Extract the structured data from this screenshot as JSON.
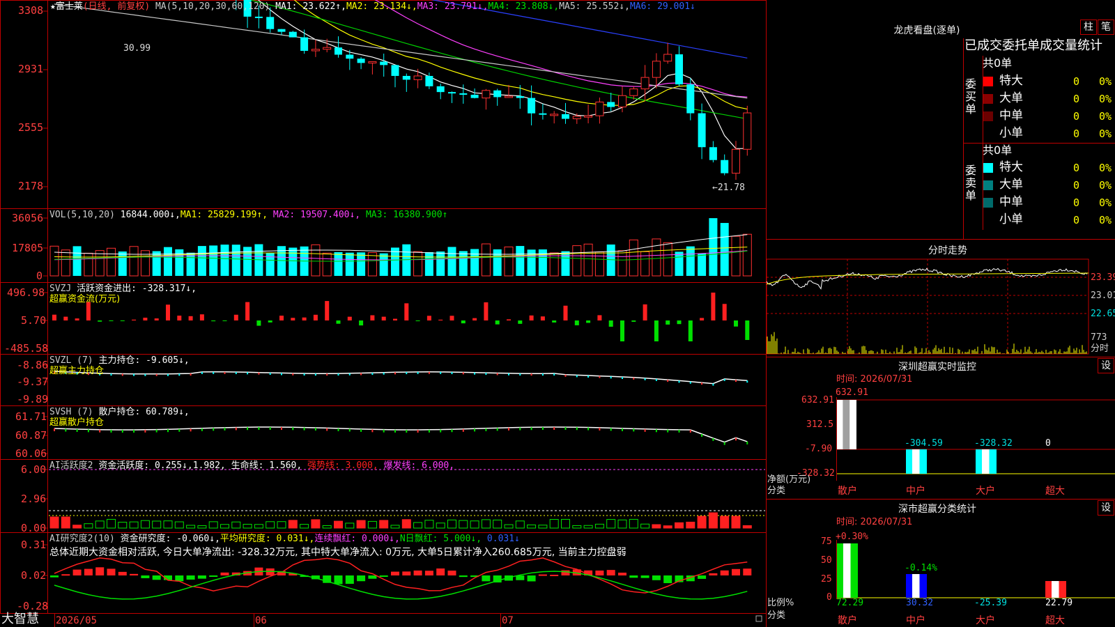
{
  "app": {
    "logo": "大智慧"
  },
  "main": {
    "price_ticks": [
      "3308",
      "2931",
      "2555",
      "2178"
    ],
    "header": {
      "star": "★",
      "name": "富士莱",
      "period": "(日线, 前复权)",
      "ma_label": "MA(5,10,20,30,60,120)",
      "ma1": "MA1: 23.622↑,",
      "ma2": "MA2: 23.134↓,",
      "ma3": "MA3: 23.791↓,",
      "ma4": "MA4: 23.808↓,",
      "ma5": "MA5: 25.552↓,",
      "ma6": "MA6: 29.001↓"
    },
    "high_label": "30.99",
    "low_label": "←21.78"
  },
  "vol": {
    "ticks": [
      "36056",
      "17805",
      "0"
    ],
    "name": "VOL(5,10,20)",
    "value": "16844.000↓,",
    "ma1": "MA1: 25829.199↑,",
    "ma2": "MA2: 19507.400↓,",
    "ma3": "MA3: 16380.900↑"
  },
  "svzj": {
    "ticks": [
      "496.98",
      "5.70",
      "-485.58"
    ],
    "name": "SVZJ",
    "value": "活跃资金进出: -328.317↓,",
    "sub": "超赢资金流(万元)"
  },
  "svzl": {
    "ticks": [
      "-8.86",
      "-9.37",
      "-9.89"
    ],
    "name": "SVZL (7)",
    "value": "主力持仓: -9.605↓,",
    "sub": "超赢主力持仓"
  },
  "svsh": {
    "ticks": [
      "61.71",
      "60.87",
      "60.06"
    ],
    "name": "SVSH (7)",
    "value": "散户持仓: 60.789↓,",
    "sub": "超赢散户持仓"
  },
  "ai1": {
    "ticks": [
      "6.00",
      "2.96",
      "0.00"
    ],
    "name": "AI活跃度2",
    "value": "资金活跃度: 0.255↓,",
    "v2": "1.982,",
    "v3": "生命线: 1.560,",
    "v4": "强势线: 3.000,",
    "v5": "爆发线: 6.000,"
  },
  "ai2": {
    "ticks": [
      "0.31",
      "0.02",
      "-0.28"
    ],
    "name": "AI研究度2(10)",
    "v1": "资金研究度: -0.060↓,",
    "v2": "平均研究度: 0.031↓,",
    "v3": "连续飘红: 0.000↓,",
    "v4": "N日飘红: 5.000↓,",
    "v5": "0.031↓",
    "summary": "总体近期大资金相对活跃, 今日大单净流出: -328.32万元, 其中特大单净流入: 0万元, 大单5日累计净入260.685万元, 当前主力控盘弱"
  },
  "time_axis": {
    "d1": "2026/05",
    "d2": "06",
    "d3": "07"
  },
  "lhb": {
    "title": "龙虎看盘(逐单)",
    "btn1": "柱",
    "btn2": "笔",
    "tabs": "已成交委托单成交量统计",
    "buy_label": "委买单",
    "sell_label": "委卖单",
    "total_buy": "共0单",
    "total_sell": "共0单",
    "buy_rows": [
      {
        "label": "特大",
        "count": "0",
        "pct": "0%"
      },
      {
        "label": "大单",
        "count": "0",
        "pct": "0%"
      },
      {
        "label": "中单",
        "count": "0",
        "pct": "0%"
      },
      {
        "label": "小单",
        "count": "0",
        "pct": "0%"
      }
    ],
    "sell_rows": [
      {
        "label": "特大",
        "count": "0",
        "pct": "0%"
      },
      {
        "label": "大单",
        "count": "0",
        "pct": "0%"
      },
      {
        "label": "中单",
        "count": "0",
        "pct": "0%"
      },
      {
        "label": "小单",
        "count": "0",
        "pct": "0%"
      }
    ]
  },
  "fenshi": {
    "title": "分时走势",
    "ticks": [
      "23.39",
      "23.01",
      "22.65"
    ],
    "vol_tick": "773",
    "vol_label": "分时"
  },
  "sz_monitor": {
    "title": "深圳超赢实时监控",
    "btn": "设",
    "time": "时间: 2026/07/31",
    "ticks": [
      "632.91",
      "312.5",
      "-7.90",
      "-328.32"
    ],
    "unit1": "净额(万元)",
    "unit2": "分类",
    "cats": [
      "散户",
      "中户",
      "大户",
      "超大"
    ],
    "values": [
      "632.91",
      "-304.59",
      "-328.32",
      "0"
    ]
  },
  "sz_class": {
    "title": "深市超赢分类统计",
    "btn": "设",
    "time": "时间: 2026/07/31",
    "ticks": [
      "75",
      "50",
      "25",
      "0"
    ],
    "unit1": "比例%",
    "unit2": "分类",
    "cats": [
      "散户",
      "中户",
      "大户",
      "超大"
    ],
    "top_values": [
      "+0.30%",
      "-0.14%"
    ],
    "bottom_values": [
      "72.29",
      "30.32",
      "-25.39",
      "22.79"
    ]
  }
}
